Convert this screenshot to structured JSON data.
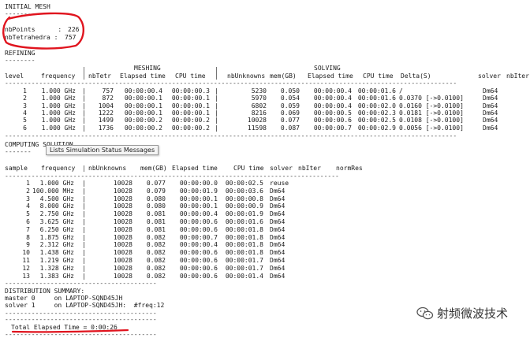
{
  "initial_mesh": {
    "title": "INITIAL MESH",
    "underline": "-----------",
    "nbpoints_label": "nbPoints      :",
    "nbpoints_value": "226",
    "nbtetra_label": "nbTetrahedra :",
    "nbtetra_value": "757"
  },
  "refining": {
    "title": "REFINING",
    "underline": "--------",
    "group_meshing": "MESHING",
    "group_solving": "SOLVING",
    "headers": [
      "level",
      "frequency",
      "nbTetr",
      "Elapsed time",
      "CPU time",
      "nbUnknowns",
      "mem(GB)",
      "Elapsed time",
      "CPU time",
      "Delta(S)",
      "solver",
      "nbIter"
    ],
    "rows": [
      [
        "1",
        "1.000 GHz",
        "757",
        "00:00:00.4",
        "00:00:00.3",
        "5230",
        "0.050",
        "00:00:00.4",
        "00:00:01.6",
        "/",
        "Dm64",
        ""
      ],
      [
        "2",
        "1.000 GHz",
        "872",
        "00:00:00.1",
        "00:00:00.1",
        "5970",
        "0.054",
        "00:00:00.4",
        "00:00:01.6",
        "0.0370 [->0.0100]",
        "Dm64",
        ""
      ],
      [
        "3",
        "1.000 GHz",
        "1004",
        "00:00:00.1",
        "00:00:00.1",
        "6802",
        "0.059",
        "00:00:00.4",
        "00:00:02.0",
        "0.0160 [->0.0100]",
        "Dm64",
        ""
      ],
      [
        "4",
        "1.000 GHz",
        "1222",
        "00:00:00.1",
        "00:00:00.1",
        "8216",
        "0.069",
        "00:00:00.5",
        "00:00:02.3",
        "0.0181 [->0.0100]",
        "Dm64",
        ""
      ],
      [
        "5",
        "1.000 GHz",
        "1499",
        "00:00:00.2",
        "00:00:00.2",
        "10028",
        "0.077",
        "00:00:00.6",
        "00:00:02.5",
        "0.0108 [->0.0100]",
        "Dm64",
        ""
      ],
      [
        "6",
        "1.000 GHz",
        "1736",
        "00:00:00.2",
        "00:00:00.2",
        "11598",
        "0.087",
        "00:00:00.7",
        "00:00:02.9",
        "0.0056 [->0.0100]",
        "Dm64",
        ""
      ]
    ]
  },
  "computing": {
    "title": "COMPUTING SOLUTION",
    "underline": "-------",
    "tooltip": "Lists Simulation Status Messages",
    "headers": [
      "sample",
      "frequency",
      "nbUnknowns",
      "mem(GB)",
      "Elapsed time",
      "CPU time",
      "solver",
      "nbIter",
      "normRes"
    ],
    "rows": [
      [
        "1",
        "1.000 GHz",
        "10028",
        "0.077",
        "00:00:00.0",
        "00:00:02.5",
        "reuse"
      ],
      [
        "2",
        "100.000 MHz",
        "10028",
        "0.079",
        "00:00:01.9",
        "00:00:03.6",
        "Dm64"
      ],
      [
        "3",
        "4.500 GHz",
        "10028",
        "0.080",
        "00:00:00.1",
        "00:00:00.8",
        "Dm64"
      ],
      [
        "4",
        "8.000 GHz",
        "10028",
        "0.080",
        "00:00:00.1",
        "00:00:00.9",
        "Dm64"
      ],
      [
        "5",
        "2.750 GHz",
        "10028",
        "0.081",
        "00:00:00.4",
        "00:00:01.9",
        "Dm64"
      ],
      [
        "6",
        "3.625 GHz",
        "10028",
        "0.081",
        "00:00:00.6",
        "00:00:01.6",
        "Dm64"
      ],
      [
        "7",
        "6.250 GHz",
        "10028",
        "0.081",
        "00:00:00.6",
        "00:00:01.8",
        "Dm64"
      ],
      [
        "8",
        "1.875 GHz",
        "10028",
        "0.082",
        "00:00:00.7",
        "00:00:01.8",
        "Dm64"
      ],
      [
        "9",
        "2.312 GHz",
        "10028",
        "0.082",
        "00:00:00.4",
        "00:00:01.8",
        "Dm64"
      ],
      [
        "10",
        "1.438 GHz",
        "10028",
        "0.082",
        "00:00:00.6",
        "00:00:01.8",
        "Dm64"
      ],
      [
        "11",
        "1.219 GHz",
        "10028",
        "0.082",
        "00:00:00.6",
        "00:00:01.7",
        "Dm64"
      ],
      [
        "12",
        "1.328 GHz",
        "10028",
        "0.082",
        "00:00:00.6",
        "00:00:01.7",
        "Dm64"
      ],
      [
        "13",
        "1.383 GHz",
        "10028",
        "0.082",
        "00:00:00.6",
        "00:00:01.4",
        "Dm64"
      ]
    ]
  },
  "distribution": {
    "title": "DISTRIBUTION SUMMARY:",
    "master": "master 0     on LAPTOP-SQND45JH",
    "solver": "solver 1     on LAPTOP-SQND45JH:  #freq:12"
  },
  "total": {
    "text": "Total Elapsed Time = 0:00:26"
  },
  "watermark": {
    "text": "射频微波技术",
    "icon": "wechat-icon"
  },
  "colors": {
    "annotation": "#e0141e",
    "text": "#1a1a1a",
    "background": "#ffffff"
  }
}
